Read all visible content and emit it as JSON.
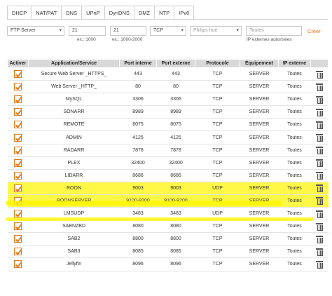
{
  "tabs": [
    "DHCP",
    "NAT/PAT",
    "DNS",
    "UPnP",
    "DynDNS",
    "DMZ",
    "NTP",
    "IPv6"
  ],
  "active_tab": "NAT/PAT",
  "form": {
    "service_select": "FTP Server",
    "port_internal": "21",
    "port_internal_hint": "ex.: 1000",
    "port_external": "21",
    "port_external_hint": "ex.: 1000-2000",
    "protocol_select": "TCP",
    "device_select": "Philips hue",
    "ip_placeholder": "Toutes",
    "ip_hint": "IP externes autorisées",
    "create_label": "Créer"
  },
  "table": {
    "headers": [
      "Activer",
      "Application/Service",
      "Port interne",
      "Port externe",
      "Protocole",
      "Équipement",
      "IP externe",
      ""
    ],
    "rows": [
      {
        "service": "Secure Web Server _HTTPS_",
        "port_int": "443",
        "port_ext": "443",
        "protocol": "TCP",
        "device": "SERVER",
        "ip": "Toutes",
        "highlight": false
      },
      {
        "service": "Web Server _HTTP_",
        "port_int": "80",
        "port_ext": "80",
        "protocol": "TCP",
        "device": "SERVER",
        "ip": "Toutes",
        "highlight": false
      },
      {
        "service": "MySQL",
        "port_int": "3306",
        "port_ext": "3306",
        "protocol": "TCP",
        "device": "SERVER",
        "ip": "Toutes",
        "highlight": false
      },
      {
        "service": "SONARR",
        "port_int": "8989",
        "port_ext": "8989",
        "protocol": "TCP",
        "device": "SERVER",
        "ip": "Toutes",
        "highlight": false
      },
      {
        "service": "REMOTE",
        "port_int": "8075",
        "port_ext": "8075",
        "protocol": "TCP",
        "device": "SERVER",
        "ip": "Toutes",
        "highlight": false
      },
      {
        "service": "ADMIN",
        "port_int": "4125",
        "port_ext": "4125",
        "protocol": "TCP",
        "device": "SERVER",
        "ip": "Toutes",
        "highlight": false
      },
      {
        "service": "RADARR",
        "port_int": "7878",
        "port_ext": "7878",
        "protocol": "TCP",
        "device": "SERVER",
        "ip": "Toutes",
        "highlight": false
      },
      {
        "service": "PLEX",
        "port_int": "32400",
        "port_ext": "32400",
        "protocol": "TCP",
        "device": "SERVER",
        "ip": "Toutes",
        "highlight": false
      },
      {
        "service": "LIDARR",
        "port_int": "8686",
        "port_ext": "8686",
        "protocol": "TCP",
        "device": "SERVER",
        "ip": "Toutes",
        "highlight": false
      },
      {
        "service": "ROON",
        "port_int": "9003",
        "port_ext": "9003",
        "protocol": "UDP",
        "device": "SERVER",
        "ip": "Toutes",
        "highlight": true
      },
      {
        "service": "ROONSERVER",
        "port_int": "9100-9200",
        "port_ext": "9100-9200",
        "protocol": "TCP",
        "device": "SERVER",
        "ip": "Toutes",
        "highlight": true
      },
      {
        "service": "LMSUDP",
        "port_int": "3483",
        "port_ext": "3483",
        "protocol": "UDP",
        "device": "SERVER",
        "ip": "Toutes",
        "highlight": false
      },
      {
        "service": "SABNZBD",
        "port_int": "8080",
        "port_ext": "8080",
        "protocol": "TCP",
        "device": "SERVER",
        "ip": "Toutes",
        "highlight": false
      },
      {
        "service": "SAB2",
        "port_int": "8800",
        "port_ext": "8800",
        "protocol": "TCP",
        "device": "SERVER",
        "ip": "Toutes",
        "highlight": false
      },
      {
        "service": "SAB3",
        "port_int": "8085",
        "port_ext": "8085",
        "protocol": "TCP",
        "device": "SERVER",
        "ip": "Toutes",
        "highlight": false
      },
      {
        "service": "Jellyfin",
        "port_int": "8096",
        "port_ext": "8096",
        "protocol": "TCP",
        "device": "SERVER",
        "ip": "Toutes",
        "highlight": false
      }
    ]
  },
  "colors": {
    "accent": "#e07a1a",
    "header_bg": "#d9d9d9",
    "highlight": "#fff500"
  }
}
